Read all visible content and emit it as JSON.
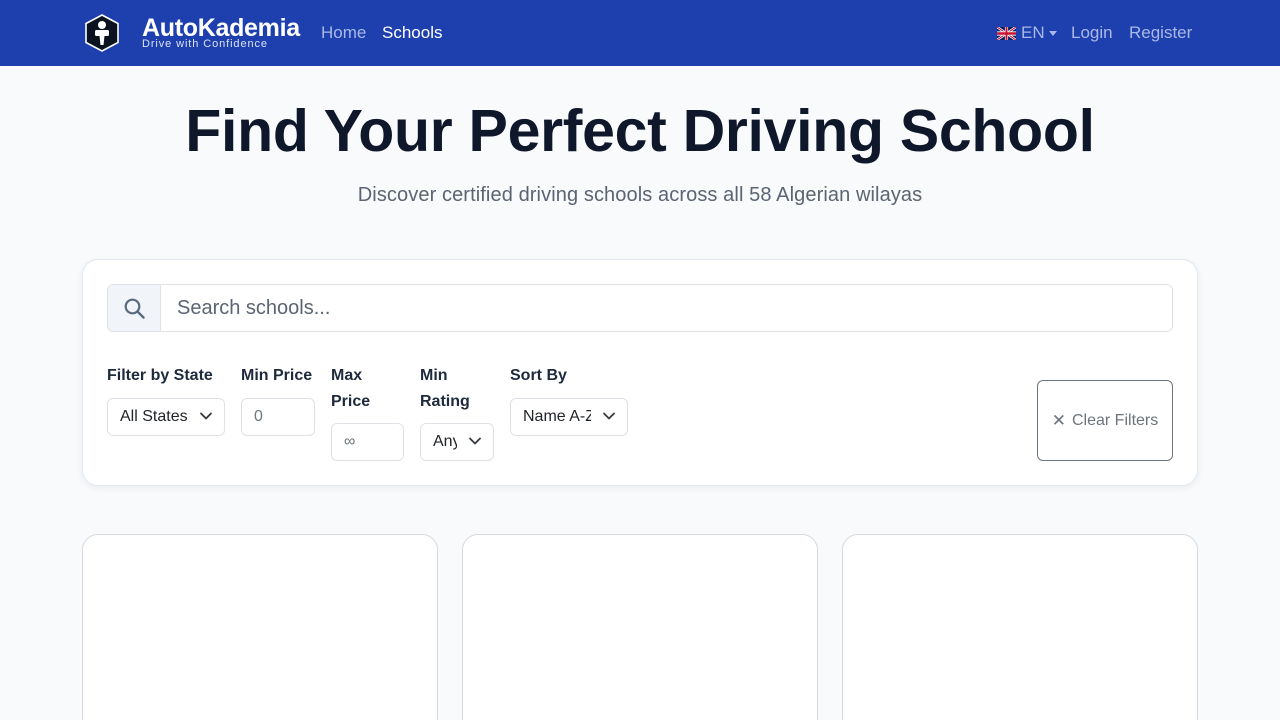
{
  "brand": {
    "name": "AutoKademia",
    "tagline": "Drive with Confidence",
    "logo_icon": "driver-shield-icon"
  },
  "nav": {
    "home": "Home",
    "schools": "Schools",
    "language": "EN",
    "language_flag": "uk-flag-icon",
    "login": "Login",
    "register": "Register"
  },
  "hero": {
    "title": "Find Your Perfect Driving School",
    "subtitle": "Discover certified driving schools across all 58 Algerian wilayas"
  },
  "search": {
    "icon": "search-icon",
    "placeholder": "Search schools..."
  },
  "filters": {
    "state_label": "Filter by State",
    "state_value": "All States",
    "min_price_label": "Min Price",
    "min_price_placeholder": "0",
    "max_price_label_line1": "Max",
    "max_price_label_line2": "Price",
    "max_price_placeholder": "∞",
    "min_rating_label_line1": "Min",
    "min_rating_label_line2": "Rating",
    "min_rating_value": "Any",
    "sort_label": "Sort By",
    "sort_value": "Name A-Z",
    "clear_label": "Clear Filters",
    "clear_icon": "close-icon"
  },
  "colors": {
    "navbar": "#1e40af",
    "page_background": "#f8fafc",
    "heading": "#0f172a"
  }
}
